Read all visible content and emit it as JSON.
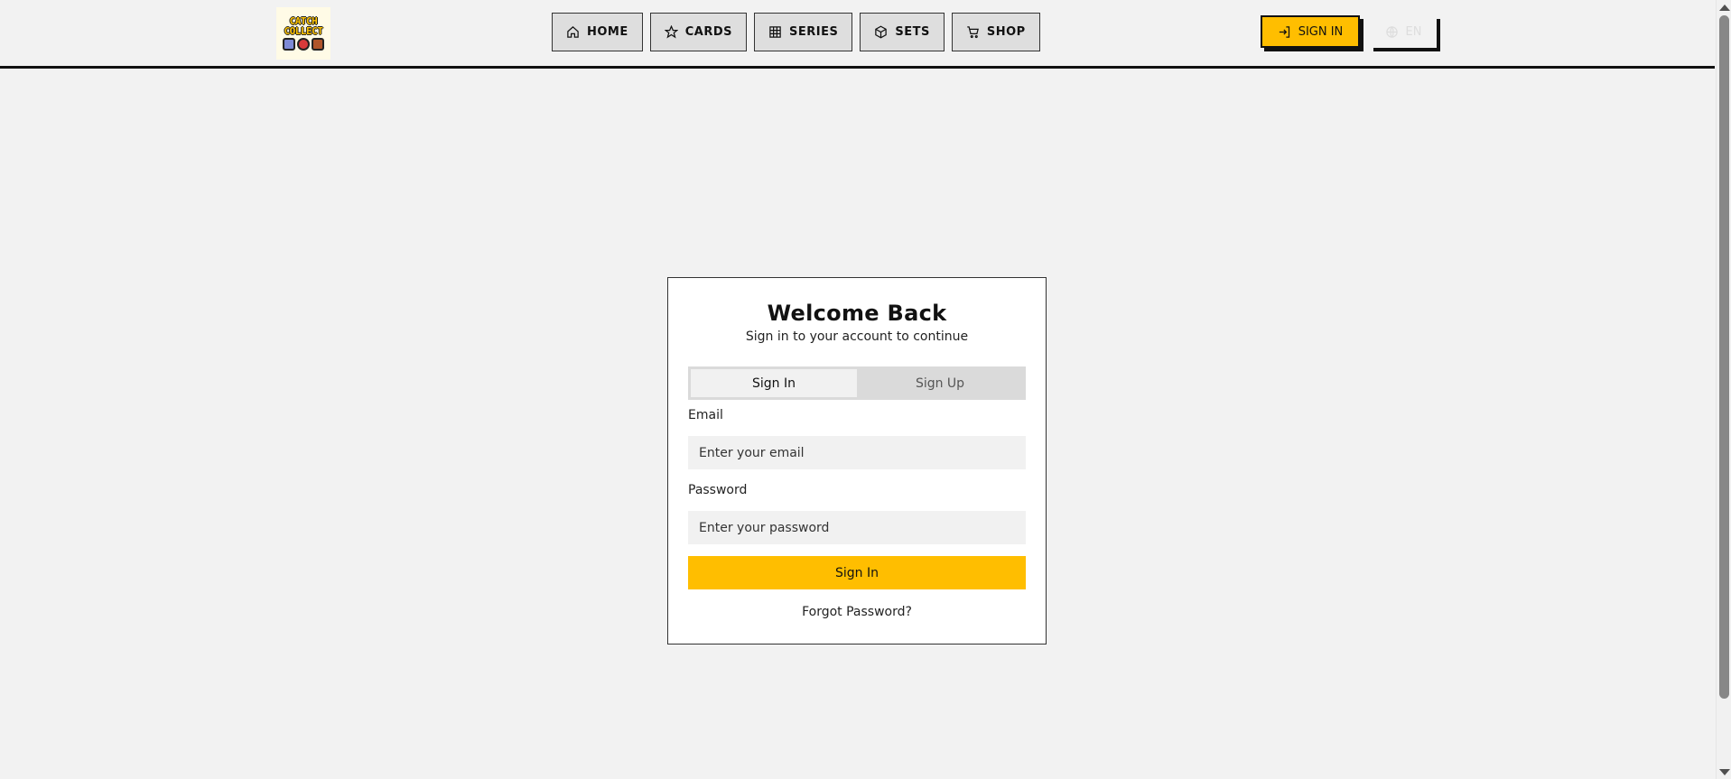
{
  "header": {
    "logo": {
      "text": "CATCH\nCOLLECT",
      "icon": "catch-collect-logo"
    },
    "nav": [
      {
        "label": "HOME",
        "icon": "home-icon"
      },
      {
        "label": "CARDS",
        "icon": "star-icon"
      },
      {
        "label": "SERIES",
        "icon": "grid-icon"
      },
      {
        "label": "SETS",
        "icon": "box-icon"
      },
      {
        "label": "SHOP",
        "icon": "cart-icon"
      }
    ],
    "sign_in_label": "SIGN IN",
    "sign_in_icon": "log-in-icon",
    "language_label": "EN",
    "language_icon": "globe-icon"
  },
  "auth": {
    "title": "Welcome Back",
    "subtitle": "Sign in to your account to continue",
    "tabs": [
      "Sign In",
      "Sign Up"
    ],
    "active_tab": "Sign In",
    "email_label": "Email",
    "email_placeholder": "Enter your email",
    "password_label": "Password",
    "password_placeholder": "Enter your password",
    "submit_label": "Sign In",
    "forgot_label": "Forgot Password?"
  },
  "colors": {
    "accent": "#ffbe00",
    "background": "#f2f2f2",
    "card": "#ffffff",
    "border": "#111111"
  }
}
